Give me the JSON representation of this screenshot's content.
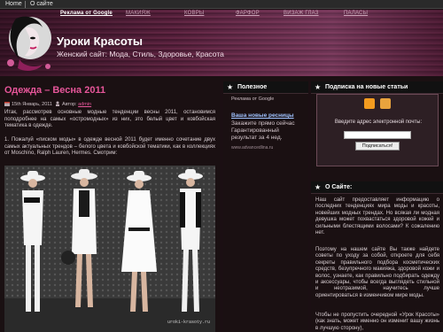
{
  "topbar": {
    "home": "Home",
    "about": "О сайте"
  },
  "nav": [
    "Реклама от Google",
    "МАКИЯЖ",
    "КОВРЫ",
    "ФАРФОР",
    "ВИЗАЖ ГЛАЗ",
    "ПАЛАСЫ"
  ],
  "site": {
    "title": "Уроки Красоты",
    "subtitle": "Женский сайт: Мода, Стиль, Здоровье, Красота"
  },
  "post": {
    "title": "Одежда – Весна 2011",
    "date": "15th Январь, 2011",
    "author_label": "Автор:",
    "author": "admin",
    "intro": "Итак, рассмотрев основные модные тенденции весны 2011, остановимся поподробнее на самых «остромодных» из них, это белый цвет и ковбойская тематика в одежде.",
    "para1": "1. Пожалуй «писком моды» в одежде весной 2011 будет именно сочетание двух самых актуальных трендов – белого цвета и ковбойской тематики, как в коллекциях от Moschino, Ralph Lauren, Hermes. Смотрим:",
    "watermark": "uroki-krasoty.ru"
  },
  "useful": {
    "heading": "Полезное",
    "ads_by": "Реклама от Google",
    "ad_title": "Ваша новые ресницы",
    "ad_text": "Закажите прямо сейчас Гарантированный результат за 4 нед.",
    "ad_url": "www.advancedlina.ru"
  },
  "subscribe": {
    "heading": "Подписка на новые статьи",
    "label": "Введите адрес электронной почты:",
    "input_value": "",
    "button": "Подписаться!"
  },
  "about": {
    "heading": "О Сайте:",
    "p1": "Наш сайт предоставляет информацию о последних тенденциях мира моды и красоты, новейших модных трендах. Но всякая ли модная девушка может похвастаться здоровой кожей и сильными блестящими волосами? К сожалению нет.",
    "p2": "Поэтому на нашем сайте Вы также найдете советы по уходу за собой, откроете для себя секреты правильного подбора косметических средств, безупречного макияжа, здоровой кожи и волос, узнаете, как правильно подбирать одежду и аксессуары, чтобы всегда выглядеть стильной и неотразимой, научитесь лучше ориентироваться в изменчивом мире моды.",
    "p3": "Чтобы не пропустить очередной «Урок Красоты» (как знать, может именно он изменит вашу жизнь в лучшую сторону),"
  },
  "colors": {
    "accent": "#e7569a",
    "header": "#5a2440",
    "background": "#1b0f13"
  }
}
